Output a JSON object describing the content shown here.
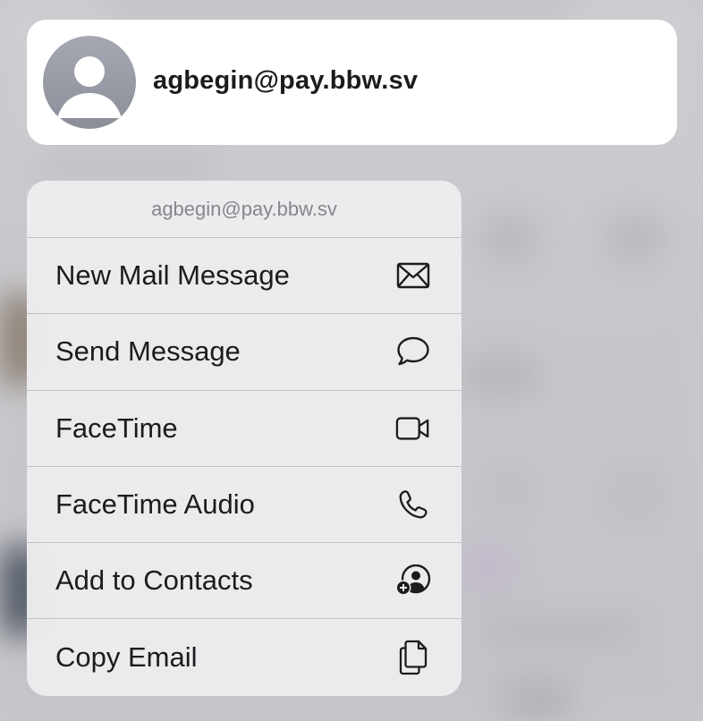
{
  "contact": {
    "name": "agbegin@pay.bbw.sv",
    "avatar_icon": "person-silhouette-icon"
  },
  "menu": {
    "header": "agbegin@pay.bbw.sv",
    "items": [
      {
        "label": "New Mail Message",
        "icon": "envelope-icon"
      },
      {
        "label": "Send Message",
        "icon": "speech-bubble-icon"
      },
      {
        "label": "FaceTime",
        "icon": "video-camera-icon"
      },
      {
        "label": "FaceTime Audio",
        "icon": "phone-icon"
      },
      {
        "label": "Add to Contacts",
        "icon": "add-person-icon"
      },
      {
        "label": "Copy Email",
        "icon": "copy-documents-icon"
      }
    ]
  },
  "colors": {
    "card_background": "#ffffff",
    "menu_background": "#ececee",
    "text_primary": "#1c1c1e",
    "text_secondary": "#86868b",
    "separator": "#c3c3c7",
    "avatar_gray": "#9a9da6"
  }
}
